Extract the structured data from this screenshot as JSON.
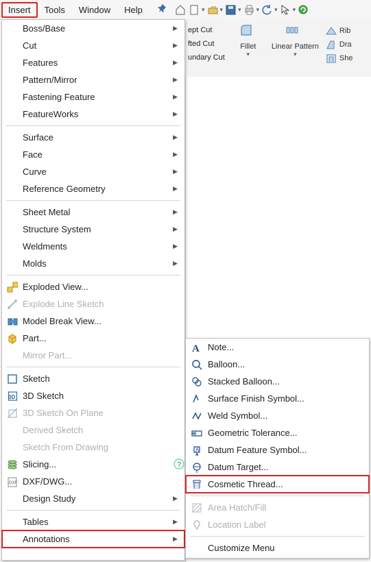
{
  "menubar": {
    "items": [
      "Insert",
      "Tools",
      "Window",
      "Help"
    ],
    "active": "Insert"
  },
  "toolbar": {
    "icons": [
      "home",
      "new",
      "open",
      "save",
      "print",
      "undo",
      "select",
      "rebuild"
    ]
  },
  "ribbon": {
    "cuts": [
      "ept Cut",
      "fted Cut",
      "undary Cut"
    ],
    "fillet": "Fillet",
    "linearpattern": "Linear Pattern",
    "right": [
      "Rib",
      "Dra",
      "She"
    ]
  },
  "insert_menu": [
    {
      "label": "Boss/Base",
      "arrow": true
    },
    {
      "label": "Cut",
      "arrow": true
    },
    {
      "label": "Features",
      "arrow": true
    },
    {
      "label": "Pattern/Mirror",
      "arrow": true
    },
    {
      "label": "Fastening Feature",
      "arrow": true
    },
    {
      "label": "FeatureWorks",
      "arrow": true
    },
    {
      "sep": true
    },
    {
      "label": "Surface",
      "arrow": true
    },
    {
      "label": "Face",
      "arrow": true
    },
    {
      "label": "Curve",
      "arrow": true
    },
    {
      "label": "Reference Geometry",
      "arrow": true
    },
    {
      "sep": true
    },
    {
      "label": "Sheet Metal",
      "arrow": true
    },
    {
      "label": "Structure System",
      "arrow": true
    },
    {
      "label": "Weldments",
      "arrow": true
    },
    {
      "label": "Molds",
      "arrow": true
    },
    {
      "sep": true
    },
    {
      "label": "Exploded View...",
      "icon": "exploded"
    },
    {
      "label": "Explode Line Sketch",
      "icon": "explodeline",
      "disabled": true
    },
    {
      "label": "Model Break View...",
      "icon": "modelbreak"
    },
    {
      "label": "Part...",
      "icon": "part"
    },
    {
      "label": "Mirror Part...",
      "disabled": true
    },
    {
      "sep": true
    },
    {
      "label": "Sketch",
      "icon": "sketch"
    },
    {
      "label": "3D Sketch",
      "icon": "sketch3d"
    },
    {
      "label": "3D Sketch On Plane",
      "icon": "sketch3dplane",
      "disabled": true
    },
    {
      "label": "Derived Sketch",
      "disabled": true
    },
    {
      "label": "Sketch From Drawing",
      "disabled": true
    },
    {
      "label": "Slicing...",
      "icon": "slicing",
      "help": true
    },
    {
      "label": "DXF/DWG...",
      "icon": "dxf"
    },
    {
      "label": "Design Study",
      "arrow": true
    },
    {
      "sep": true
    },
    {
      "label": "Tables",
      "arrow": true
    },
    {
      "label": "Annotations",
      "arrow": true,
      "highlight": true
    }
  ],
  "annotations_menu": [
    {
      "label": "Note...",
      "icon": "note"
    },
    {
      "label": "Balloon...",
      "icon": "balloon"
    },
    {
      "label": "Stacked Balloon...",
      "icon": "stackedballoon"
    },
    {
      "label": "Surface Finish Symbol...",
      "icon": "surfacefinish"
    },
    {
      "label": "Weld Symbol...",
      "icon": "weld"
    },
    {
      "label": "Geometric Tolerance...",
      "icon": "gtol"
    },
    {
      "label": "Datum Feature Symbol...",
      "icon": "datumfeature"
    },
    {
      "label": "Datum Target...",
      "icon": "datumtarget"
    },
    {
      "label": "Cosmetic Thread...",
      "icon": "cosmeticthread",
      "highlight": true
    },
    {
      "sep": true
    },
    {
      "label": "Area Hatch/Fill",
      "icon": "hatch",
      "disabled": true
    },
    {
      "label": "Location Label",
      "icon": "location",
      "disabled": true
    },
    {
      "sep": true
    },
    {
      "label": "Customize Menu"
    }
  ]
}
